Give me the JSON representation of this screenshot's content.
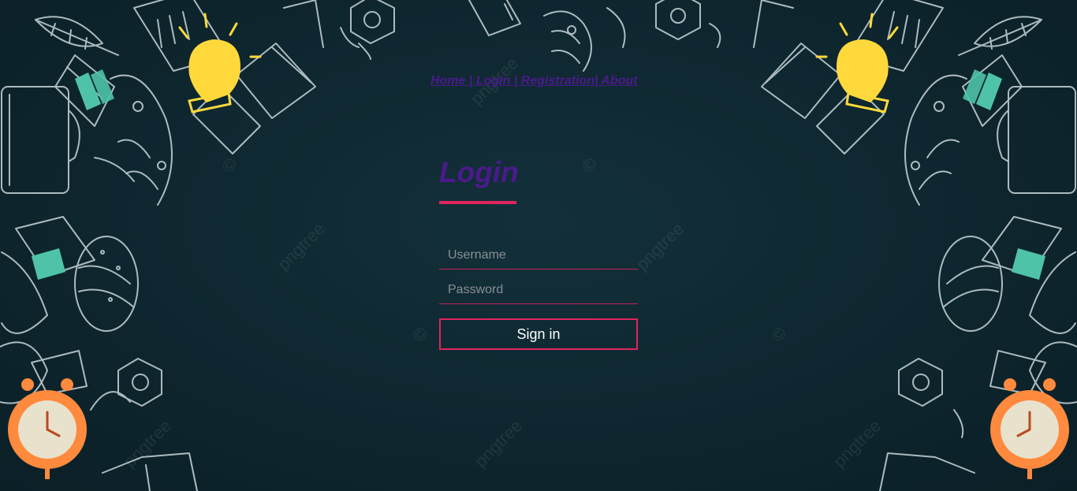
{
  "nav": {
    "home": "Home",
    "sep1": " | ",
    "login": "Login",
    "sep2": " | ",
    "registration": "Registration",
    "sep3": "| ",
    "about": "About"
  },
  "login": {
    "title": "Login"
  },
  "form": {
    "username_placeholder": "Username",
    "password_placeholder": "Password",
    "signin_label": "Sign in"
  },
  "watermark": {
    "text": "pngtree",
    "symbol": "©"
  },
  "colors": {
    "background": "#0f2831",
    "accent": "#e0245e",
    "heading": "#4b1a8c",
    "doodle": "#c9d6d8",
    "bulb": "#ffd93b",
    "teal": "#4fc3a8",
    "clock": "#ff8a3d"
  },
  "icons": [
    "light-bulb-icon",
    "beaker-icon",
    "flask-icon",
    "clock-icon",
    "leaf-icon",
    "hamburger-icon",
    "molecule-icon"
  ]
}
